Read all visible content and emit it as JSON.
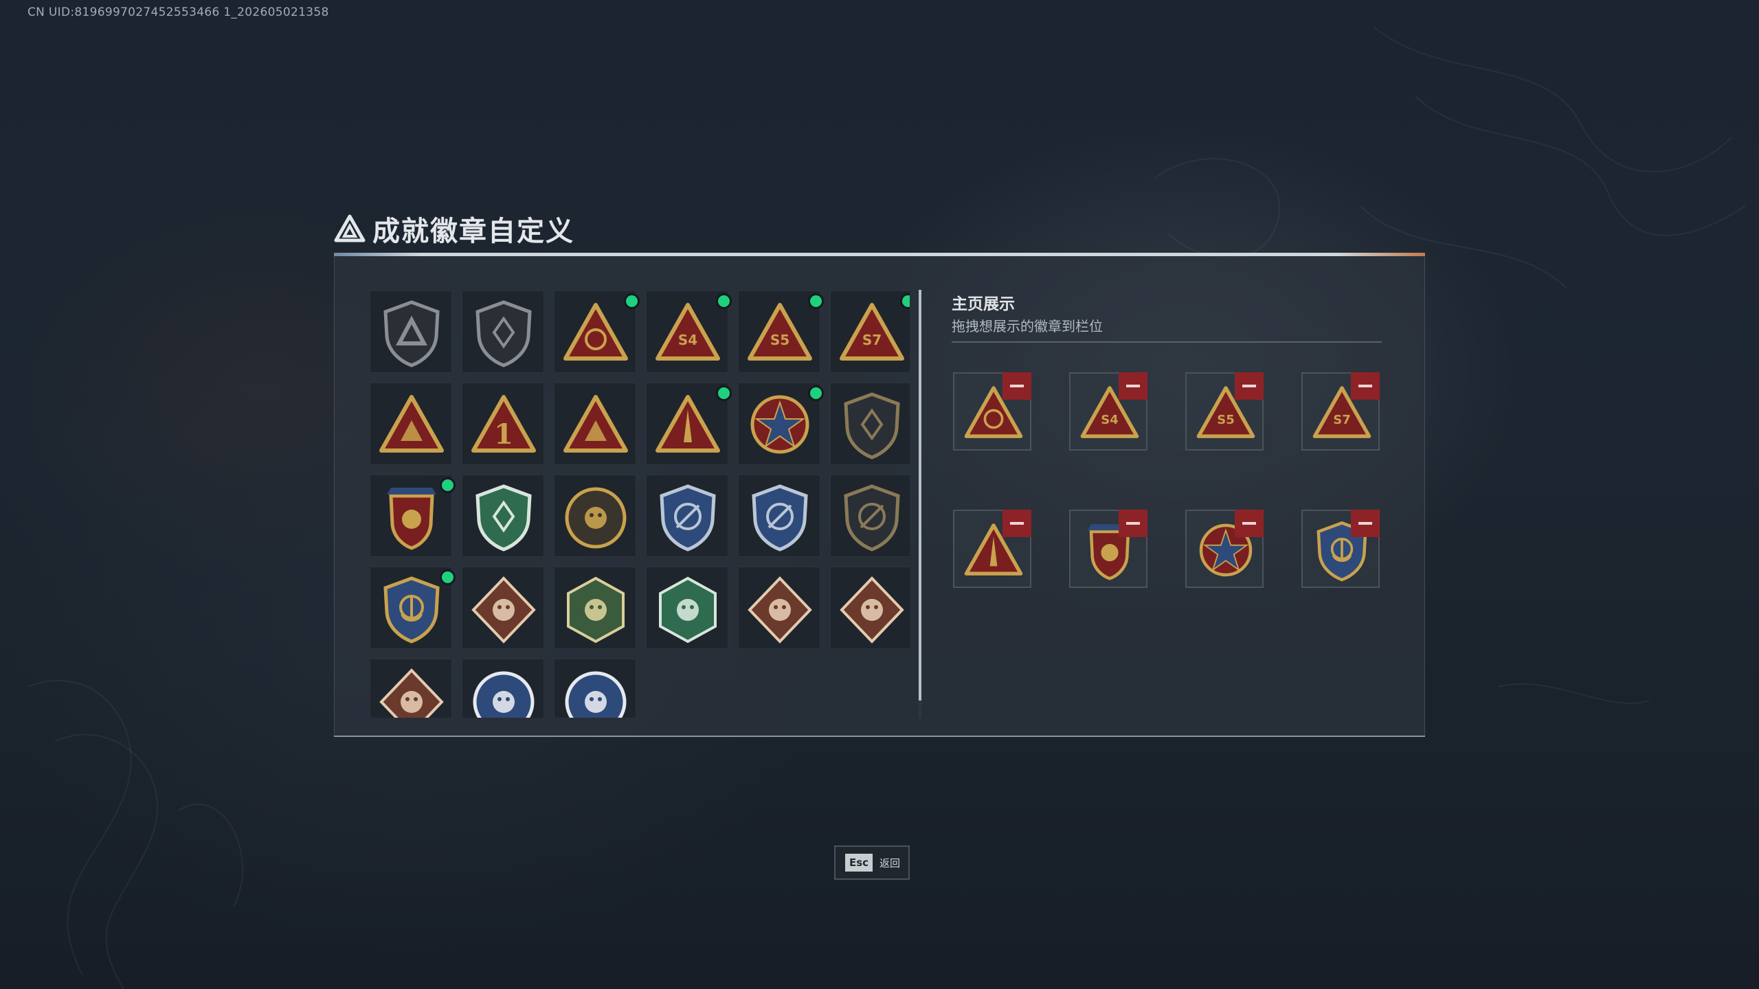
{
  "uid_text": "CN UID:8196997027452553466 1_202605021358",
  "title": {
    "tag": "",
    "text": "成就徽章自定义",
    "icon": "triangle-logo-icon"
  },
  "display": {
    "title": "主页展示",
    "subtitle": "拖拽想展示的徽章到栏位",
    "slots": [
      {
        "badge": "triangle-globe-badge-icon"
      },
      {
        "badge": "s4-emblem-badge-icon"
      },
      {
        "badge": "s5-emblem-badge-icon"
      },
      {
        "badge": "s7-emblem-badge-icon"
      },
      {
        "badge": "missile-triangle-badge-icon"
      },
      {
        "badge": "crest-badge-icon"
      },
      {
        "badge": "star-skull-badge-icon"
      },
      {
        "badge": "navy-anchor-shield-badge-icon"
      }
    ]
  },
  "badges": [
    {
      "icon": "shield-triangle-badge-icon",
      "new": false
    },
    {
      "icon": "helicopter-shield-badge-icon",
      "new": false
    },
    {
      "icon": "triangle-globe-badge-icon",
      "new": true
    },
    {
      "icon": "s4-emblem-badge-icon",
      "new": true
    },
    {
      "icon": "s5-emblem-badge-icon",
      "new": true
    },
    {
      "icon": "s7-emblem-badge-icon",
      "new": true
    },
    {
      "icon": "hand-sign-triangle-badge-icon",
      "new": false
    },
    {
      "icon": "number-one-triangle-badge-icon",
      "new": false
    },
    {
      "icon": "figures-triangle-badge-icon",
      "new": false
    },
    {
      "icon": "missile-triangle-badge-icon",
      "new": true
    },
    {
      "icon": "star-skull-badge-icon",
      "new": true
    },
    {
      "icon": "dark-shield-badge-icon",
      "new": false
    },
    {
      "icon": "crest-badge-icon",
      "new": true
    },
    {
      "icon": "green-shield-badge-icon",
      "new": false
    },
    {
      "icon": "round-emblem-badge-icon",
      "new": false
    },
    {
      "icon": "blue-crosshair-shield-badge-icon",
      "new": false
    },
    {
      "icon": "blue-crosshair-shield-2-badge-icon",
      "new": false
    },
    {
      "icon": "crosshair-shield-badge-icon",
      "new": false
    },
    {
      "icon": "navy-anchor-shield-badge-icon",
      "new": true
    },
    {
      "icon": "wolf-diamond-badge-icon",
      "new": false
    },
    {
      "icon": "wasp-hexagon-badge-icon",
      "new": false
    },
    {
      "icon": "green-hexagon-badge-icon",
      "new": false
    },
    {
      "icon": "dragon-diamond-badge-icon",
      "new": false
    },
    {
      "icon": "dragon-diamond-2-badge-icon",
      "new": false
    },
    {
      "icon": "runner-diamond-badge-icon",
      "new": false
    },
    {
      "icon": "wolf-circle-badge-icon",
      "new": false
    },
    {
      "icon": "wolf-circle-2-badge-icon",
      "new": false
    }
  ],
  "footer": {
    "key": "Esc",
    "label": "返回"
  },
  "colors": {
    "new_dot": "#1fd17d",
    "remove": "#8e2327",
    "gold": "#c9a24e",
    "red": "#7a1f1f"
  }
}
